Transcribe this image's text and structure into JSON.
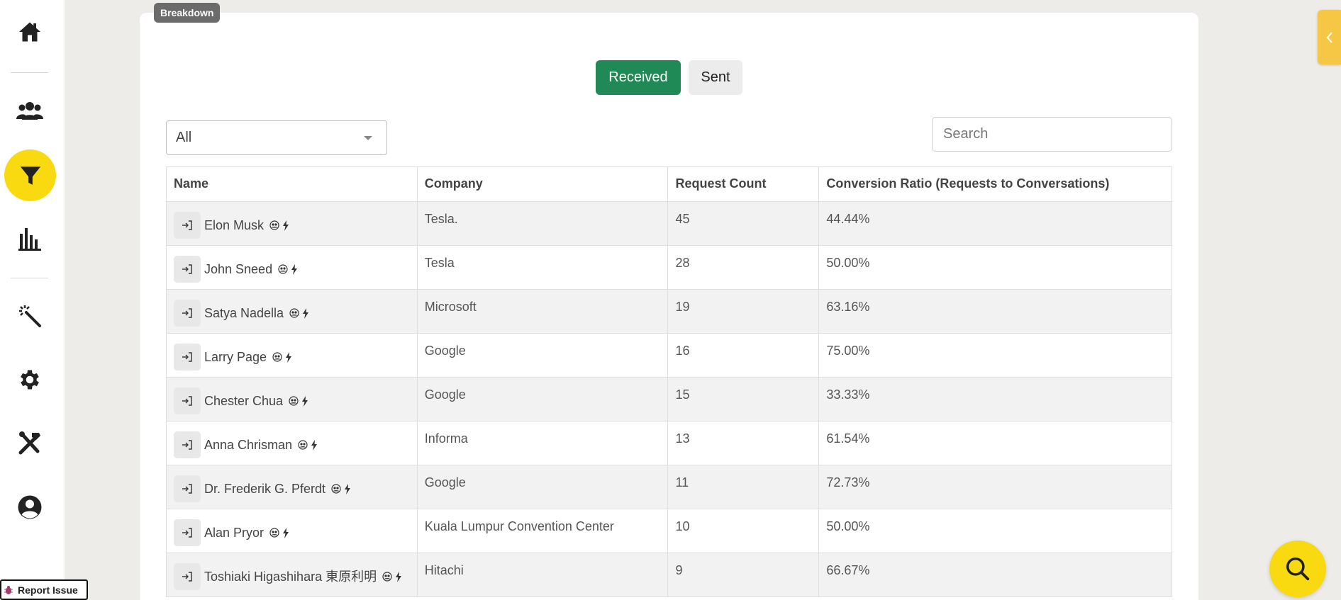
{
  "sidebar": {
    "items": [
      {
        "icon": "home-icon",
        "active": false
      },
      {
        "icon": "users-icon",
        "active": false
      },
      {
        "icon": "funnel-icon",
        "active": true
      },
      {
        "icon": "bar-chart-icon",
        "active": false
      },
      {
        "icon": "magic-wand-icon",
        "active": false
      },
      {
        "icon": "gear-icon",
        "active": false
      },
      {
        "icon": "tools-icon",
        "active": false
      },
      {
        "icon": "user-circle-icon",
        "active": false
      }
    ],
    "active_color": "#f9d90f"
  },
  "report_issue": {
    "label": "Report Issue",
    "icon": "bug-icon"
  },
  "card": {
    "badge": "Breakdown"
  },
  "toggle": {
    "received_label": "Received",
    "sent_label": "Sent",
    "active": "Received",
    "active_color": "#1f8a55"
  },
  "filter": {
    "selected": "All"
  },
  "search": {
    "placeholder": "Search",
    "value": ""
  },
  "table": {
    "headers": {
      "name": "Name",
      "company": "Company",
      "count": "Request Count",
      "ratio": "Conversion Ratio (Requests to Conversations)"
    },
    "rows": [
      {
        "name": "Elon Musk",
        "company": "Tesla.",
        "count": "45",
        "ratio": "44.44%"
      },
      {
        "name": "John Sneed",
        "company": "Tesla",
        "count": "28",
        "ratio": "50.00%"
      },
      {
        "name": "Satya Nadella",
        "company": "Microsoft",
        "count": "19",
        "ratio": "63.16%"
      },
      {
        "name": "Larry Page",
        "company": "Google",
        "count": "16",
        "ratio": "75.00%"
      },
      {
        "name": "Chester Chua",
        "company": "Google",
        "count": "15",
        "ratio": "33.33%"
      },
      {
        "name": "Anna Chrisman",
        "company": "Informa",
        "count": "13",
        "ratio": "61.54%"
      },
      {
        "name": "Dr. Frederik G. Pferdt",
        "company": "Google",
        "count": "11",
        "ratio": "72.73%"
      },
      {
        "name": "Alan Pryor",
        "company": "Kuala Lumpur Convention Center",
        "count": "10",
        "ratio": "50.00%"
      },
      {
        "name": "Toshiaki Higashihara 東原利明",
        "company": "Hitachi",
        "count": "9",
        "ratio": "66.67%"
      }
    ]
  },
  "floating": {
    "drawer_icon": "chevron-left-icon",
    "search_icon": "search-icon",
    "drawer_color": "#f6c744"
  }
}
